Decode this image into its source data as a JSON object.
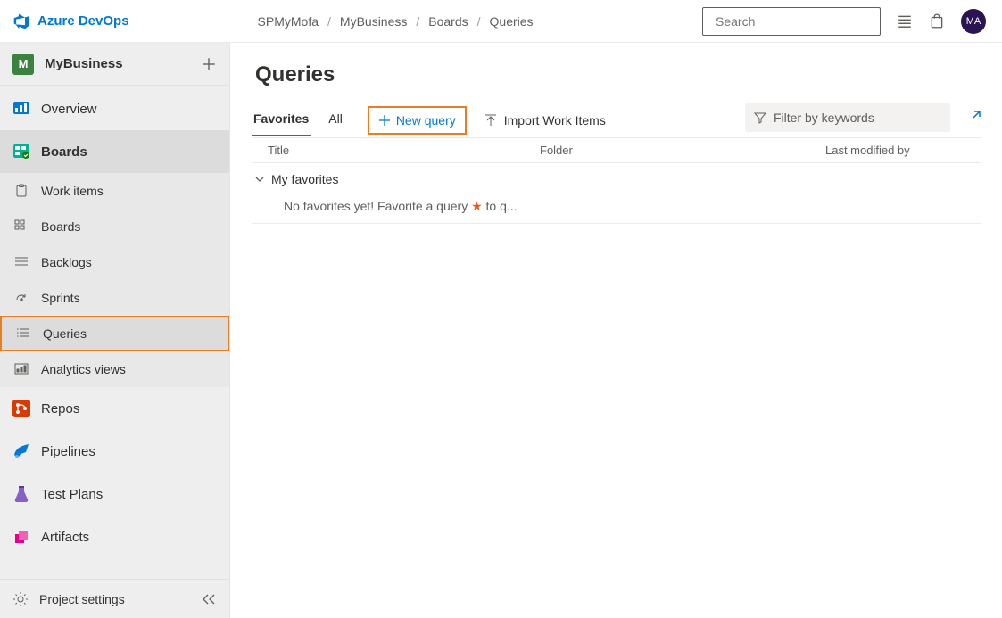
{
  "brand": {
    "name": "Azure DevOps"
  },
  "breadcrumb": [
    "SPMyMofa",
    "MyBusiness",
    "Boards",
    "Queries"
  ],
  "search": {
    "placeholder": "Search"
  },
  "avatar": {
    "initials": "MA"
  },
  "project": {
    "name": "MyBusiness",
    "initial": "M"
  },
  "nav_sections": [
    {
      "key": "overview",
      "label": "Overview"
    },
    {
      "key": "boards",
      "label": "Boards",
      "selected": true
    },
    {
      "key": "repos",
      "label": "Repos"
    },
    {
      "key": "pipelines",
      "label": "Pipelines"
    },
    {
      "key": "testplans",
      "label": "Test Plans"
    },
    {
      "key": "artifacts",
      "label": "Artifacts"
    }
  ],
  "boards_sub": [
    {
      "key": "workitems",
      "label": "Work items"
    },
    {
      "key": "boardssub",
      "label": "Boards"
    },
    {
      "key": "backlogs",
      "label": "Backlogs"
    },
    {
      "key": "sprints",
      "label": "Sprints"
    },
    {
      "key": "queries",
      "label": "Queries",
      "selected": true
    },
    {
      "key": "analytics",
      "label": "Analytics views"
    }
  ],
  "footer_nav": {
    "label": "Project settings"
  },
  "page": {
    "title": "Queries",
    "pivots": {
      "favorites": "Favorites",
      "all": "All"
    },
    "new_query": "New query",
    "import": "Import Work Items",
    "filter_placeholder": "Filter by keywords",
    "columns": {
      "title": "Title",
      "folder": "Folder",
      "last": "Last modified by"
    },
    "group": "My favorites",
    "empty_pre": "No favorites yet! Favorite a query ",
    "empty_post": " to q..."
  }
}
